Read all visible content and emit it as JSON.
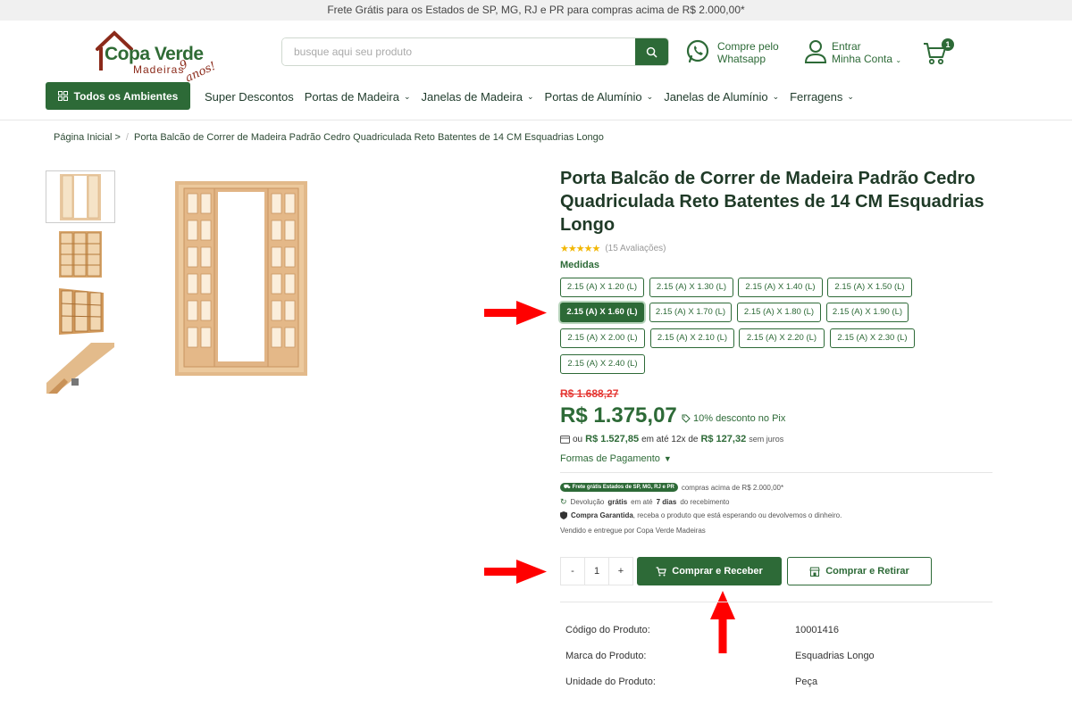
{
  "topbar": {
    "text": "Frete Grátis para os Estados de SP, MG, RJ e PR para compras acima de R$ 2.000,00*"
  },
  "logo": {
    "name": "Copa Verde",
    "sub": "Madeiras",
    "years": "9 anos!"
  },
  "search": {
    "placeholder": "busque aqui seu produto"
  },
  "whatsapp": {
    "line1": "Compre pelo",
    "line2": "Whatsapp"
  },
  "account": {
    "line1": "Entrar",
    "line2": "Minha Conta"
  },
  "cart": {
    "count": "1"
  },
  "nav": {
    "all_label": "Todos os Ambientes",
    "items": [
      "Super Descontos",
      "Portas de Madeira",
      "Janelas de Madeira",
      "Portas de Alumínio",
      "Janelas de Alumínio",
      "Ferragens"
    ]
  },
  "breadcrumb": {
    "home": "Página Inicial >",
    "current": "Porta Balcão de Correr de Madeira Padrão Cedro Quadriculada Reto Batentes de 14 CM Esquadrias Longo"
  },
  "product": {
    "title": "Porta Balcão de Correr de Madeira Padrão Cedro Quadriculada Reto Batentes de 14 CM Esquadrias Longo",
    "stars": "★★★★★",
    "reviews": "(15 Avaliações)",
    "medidas_label": "Medidas",
    "sizes": [
      "2.15 (A) X 1.20 (L)",
      "2.15 (A) X 1.30 (L)",
      "2.15 (A) X 1.40 (L)",
      "2.15 (A) X 1.50 (L)",
      "2.15 (A) X 1.60 (L)",
      "2.15 (A) X 1.70 (L)",
      "2.15 (A) X 1.80 (L)",
      "2.15 (A) X 1.90 (L)",
      "2.15 (A) X 2.00 (L)",
      "2.15 (A) X 2.10 (L)",
      "2.15 (A) X 2.20 (L)",
      "2.15 (A) X 2.30 (L)",
      "2.15 (A) X 2.40 (L)"
    ],
    "selected_size": "2.15 (A) X 1.60 (L)",
    "old_price": "R$ 1.688,27",
    "price": "R$ 1.375,07",
    "pix": "10% desconto no Pix",
    "install_pre": "ou",
    "install_total": "R$ 1.527,85",
    "install_mid": "em até 12x de",
    "install_value": "R$ 127,32",
    "install_post": "sem juros",
    "formas": "Formas de Pagamento",
    "ship_pill": "Frete grátis Estados de SP, MG, RJ e PR",
    "ship_text": "compras acima de R$ 2.000,00*",
    "return_pre": "Devolução",
    "return_bold": "grátis",
    "return_mid": "em até",
    "return_days": "7 dias",
    "return_post": "do recebimento",
    "guarantee_bold": "Compra Garantida",
    "guarantee_text": ", receba o produto que está esperando ou devolvemos o dinheiro.",
    "seller": "Vendido e entregue por Copa Verde Madeiras",
    "qty_minus": "-",
    "qty_value": "1",
    "qty_plus": "+",
    "buy_receive": "Comprar e Receber",
    "buy_pickup": "Comprar e Retirar"
  },
  "specs": [
    {
      "k": "Código do Produto:",
      "v": "10001416"
    },
    {
      "k": "Marca do Produto:",
      "v": "Esquadrias Longo"
    },
    {
      "k": "Unidade do Produto:",
      "v": "Peça"
    }
  ],
  "colors": {
    "brand": "#2d6a37",
    "accent_red": "#e53935",
    "arrow_red": "#ff0000"
  }
}
